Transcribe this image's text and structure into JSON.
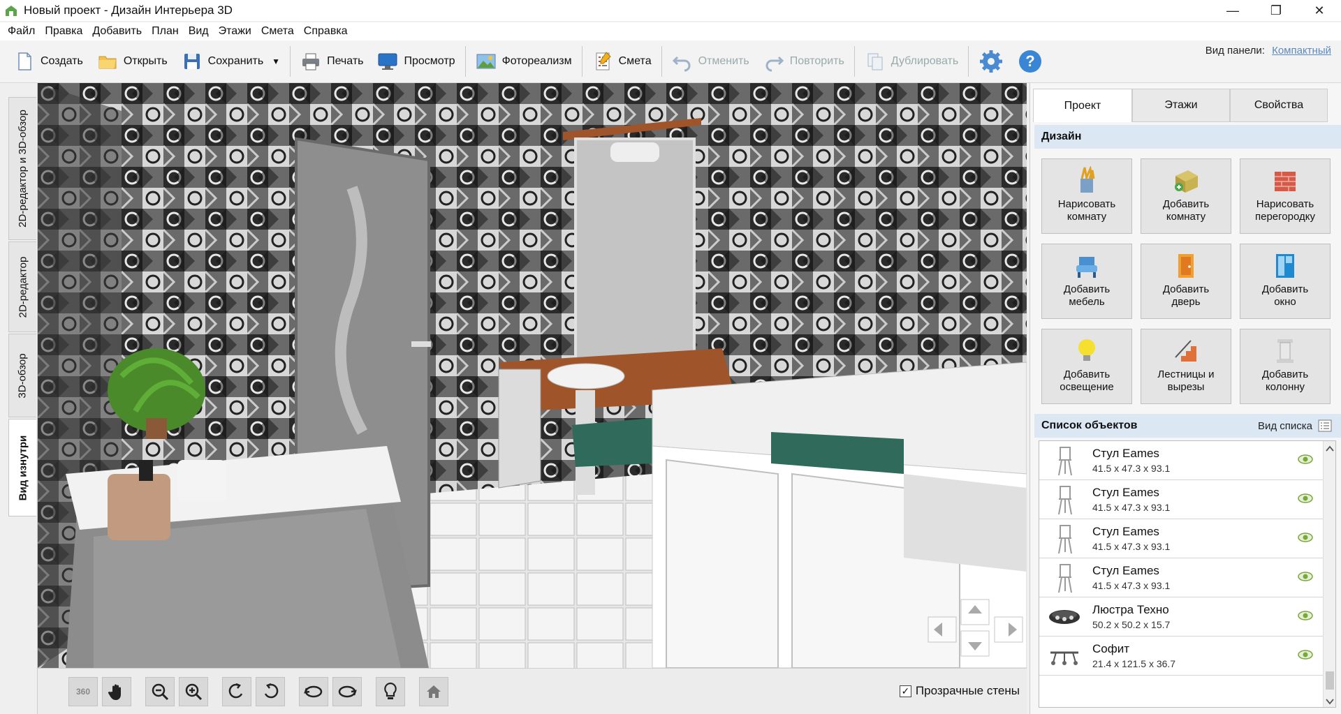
{
  "window": {
    "title": "Новый проект - Дизайн Интерьера 3D",
    "minimize": "—",
    "restore": "❐",
    "close": "✕"
  },
  "menu": [
    "Файл",
    "Правка",
    "Добавить",
    "План",
    "Вид",
    "Этажи",
    "Смета",
    "Справка"
  ],
  "toolbar": {
    "create": "Создать",
    "open": "Открыть",
    "save": "Сохранить",
    "save_arrow": "▼",
    "print": "Печать",
    "preview": "Просмотр",
    "photorealism": "Фотореализм",
    "estimate": "Смета",
    "undo": "Отменить",
    "redo": "Повторить",
    "duplicate": "Дублировать",
    "panel_view_label": "Вид панели:",
    "panel_view_value": "Компактный"
  },
  "left_tabs": [
    "2D-редактор и 3D-обзор",
    "2D-редактор",
    "3D-обзор",
    "Вид изнутри"
  ],
  "view_controls": {
    "rotate_360_icon": "360",
    "transparent_walls": "Прозрачные стены",
    "transparent_walls_checked": true,
    "check_mark": "✓"
  },
  "right_panel": {
    "tabs": [
      "Проект",
      "Этажи",
      "Свойства"
    ],
    "design_header": "Дизайн",
    "design_buttons": [
      {
        "label": "Нарисовать\nкомнату",
        "icon": "pencils-icon"
      },
      {
        "label": "Добавить\nкомнату",
        "icon": "room-box-icon"
      },
      {
        "label": "Нарисовать\nперегородку",
        "icon": "brick-wall-icon"
      },
      {
        "label": "Добавить\nмебель",
        "icon": "armchair-icon"
      },
      {
        "label": "Добавить\nдверь",
        "icon": "door-icon"
      },
      {
        "label": "Добавить\nокно",
        "icon": "window-icon"
      },
      {
        "label": "Добавить\nосвещение",
        "icon": "lightbulb-icon"
      },
      {
        "label": "Лестницы и\nвырезы",
        "icon": "stairs-icon"
      },
      {
        "label": "Добавить\nколонну",
        "icon": "column-icon"
      }
    ],
    "objects_header": "Список объектов",
    "list_view_label": "Вид списка",
    "objects": [
      {
        "name": "Стул Eames",
        "dims": "41.5 x 47.3 x 93.1",
        "icon": "chair-icon"
      },
      {
        "name": "Стул Eames",
        "dims": "41.5 x 47.3 x 93.1",
        "icon": "chair-icon"
      },
      {
        "name": "Стул Eames",
        "dims": "41.5 x 47.3 x 93.1",
        "icon": "chair-icon"
      },
      {
        "name": "Стул Eames",
        "dims": "41.5 x 47.3 x 93.1",
        "icon": "chair-icon"
      },
      {
        "name": "Люстра Техно",
        "dims": "50.2 x 50.2 x 15.7",
        "icon": "chandelier-icon"
      },
      {
        "name": "Софит",
        "dims": "21.4 x 121.5 x 36.7",
        "icon": "spotlight-icon"
      }
    ]
  },
  "colors": {
    "section_header_bg": "#dbe8f4",
    "link": "#5a8ac0",
    "eye_green": "#7aa83a"
  }
}
